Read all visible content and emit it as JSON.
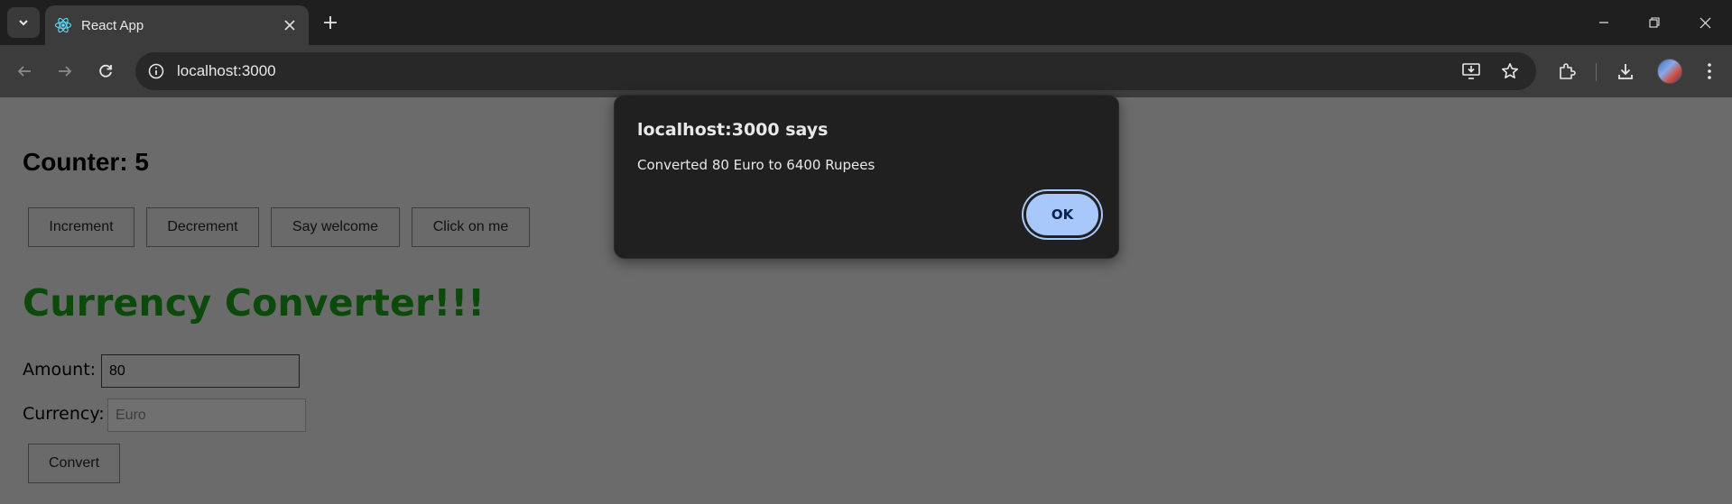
{
  "browser": {
    "tab": {
      "title": "React App"
    },
    "address": {
      "url": "localhost:3000"
    }
  },
  "page": {
    "counter_text": "Counter: 5",
    "buttons": {
      "increment": "Increment",
      "decrement": "Decrement",
      "say_welcome": "Say welcome",
      "click_on_me": "Click on me"
    },
    "converter": {
      "title": "Currency Converter!!!",
      "amount_label": "Amount:",
      "amount_value": "80",
      "currency_label": "Currency:",
      "currency_placeholder": "Euro",
      "convert_label": "Convert"
    }
  },
  "dialog": {
    "heading": "localhost:3000 says",
    "message": "Converted 80 Euro to 6400 Rupees",
    "ok_label": "OK"
  },
  "colors": {
    "accent": "#a8c7fa",
    "converter_title": "#0b4a0b",
    "page_overlay": "#6b6b6b"
  }
}
